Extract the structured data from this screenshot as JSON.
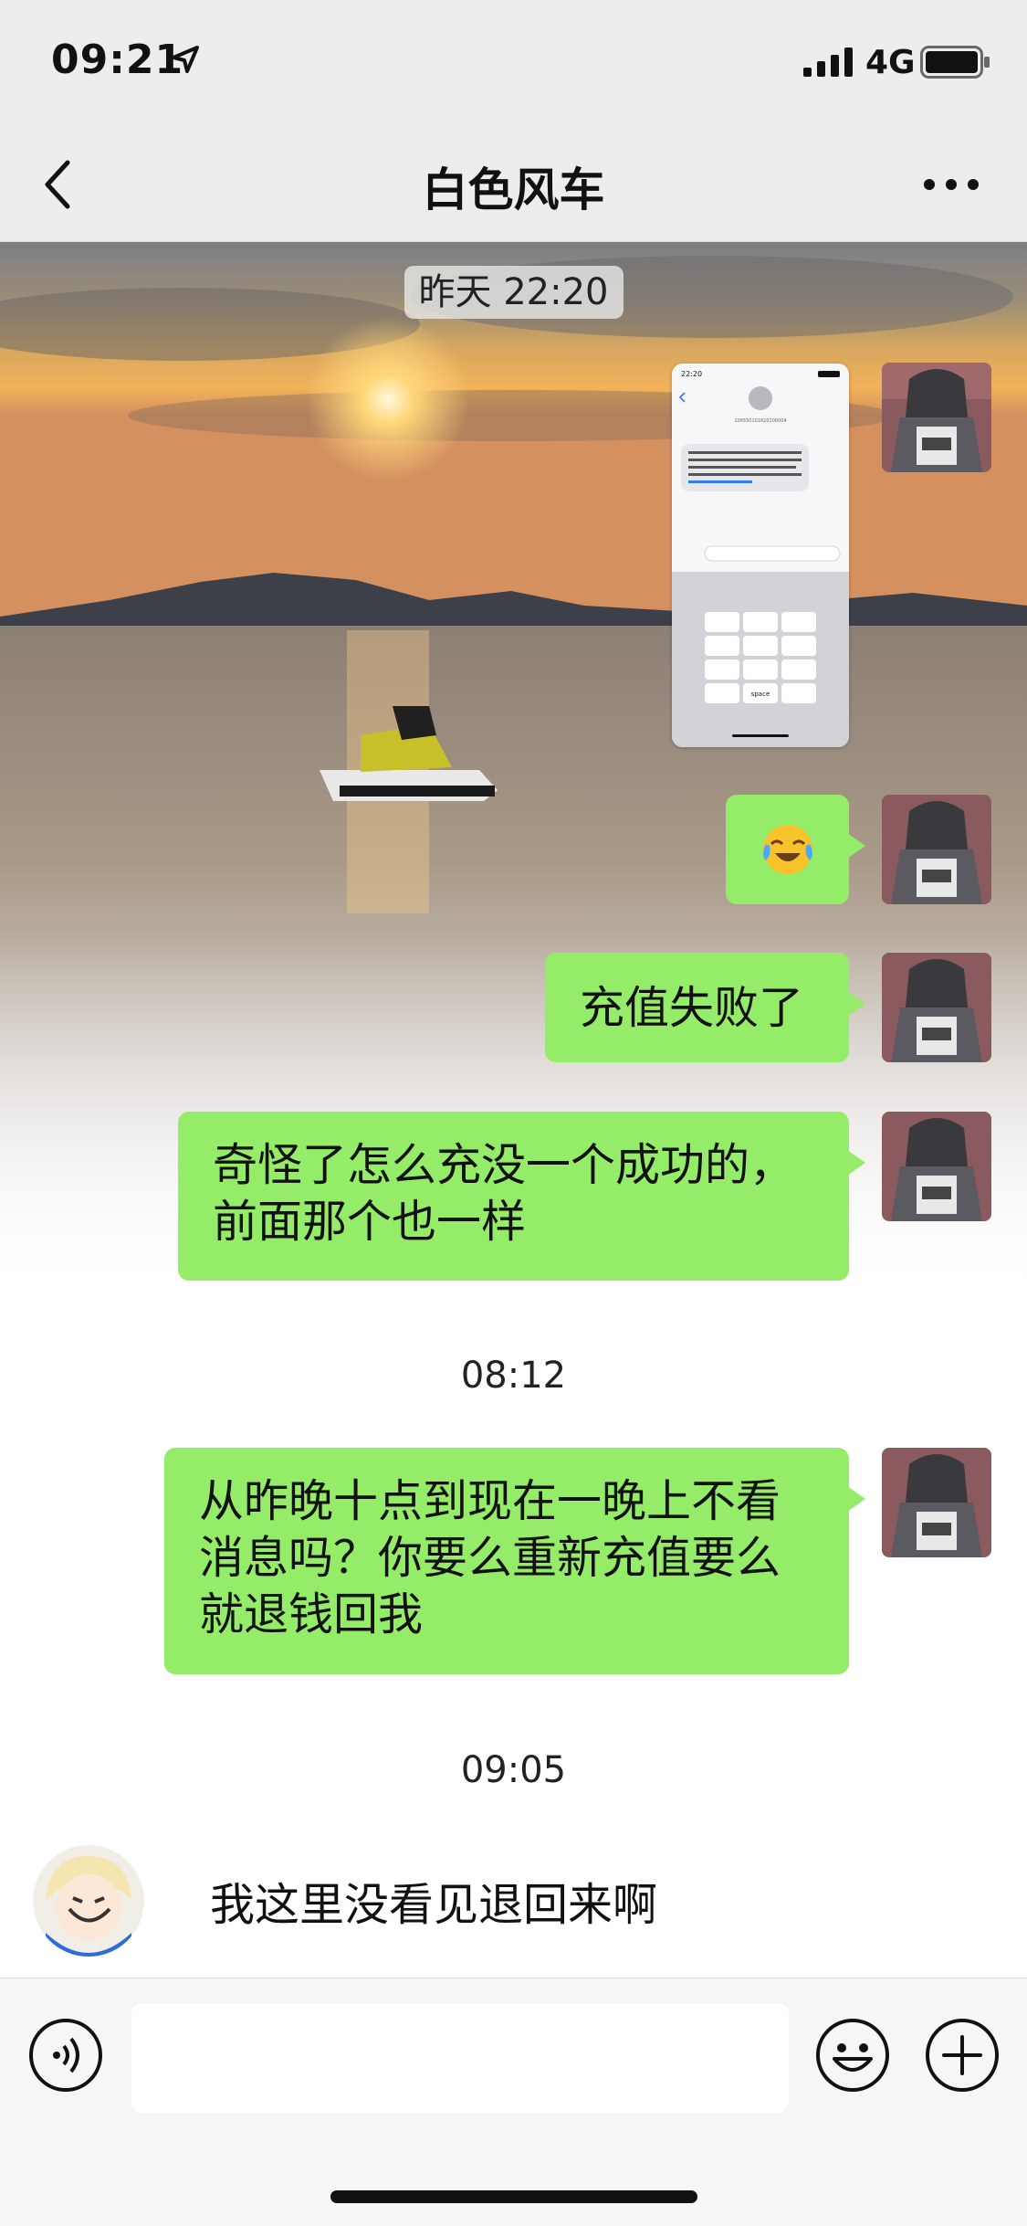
{
  "status_bar": {
    "time": "09:21",
    "network": "4G",
    "icons": [
      "location-arrow-icon",
      "cellular-signal-icon",
      "battery-icon"
    ]
  },
  "nav": {
    "title": "白色风车",
    "back_icon": "chevron-left-icon",
    "more_icon": "more-dots-icon"
  },
  "messages": {
    "ts_1": "昨天 22:20",
    "msg_2_emoji": "😭",
    "msg_3": "充值失败了",
    "msg_4_line1": "奇怪了怎么充没一个成功的，",
    "msg_4_line2": "前面那个也一样",
    "ts_2": "08:12",
    "msg_5_line1": "从昨晚十点到现在一晚上不看",
    "msg_5_line2": "消息吗？你要么重新充值要么",
    "msg_5_line3": "就退钱回我",
    "ts_3": "09:05",
    "incoming_1": "我这里没看见退回来啊"
  },
  "screenshot_message": {
    "time": "22:20",
    "sender_number": "106550101820100004",
    "text": "尊敬的用户，您好！因运营商系统维护，您充值的 30 元话费失败，金额已原路退回，请查收！如有疑问请拨电客服：4007988852【掌上银行】",
    "keyboard_keys": [
      "，",
      "ABC",
      "DEF",
      "⌫",
      "GHI",
      "JKL",
      "MNO",
      "清除",
      "PQRS",
      "TUV",
      "WXYZ",
      "符号",
      "123",
      "space",
      "中文",
      "换行"
    ]
  },
  "input_bar": {
    "icons": [
      "voice-icon",
      "emoji-icon",
      "plus-icon"
    ]
  },
  "colors": {
    "bubble_out": "#95ec69",
    "nav_bg": "#ededed",
    "input_bg": "#f6f6f6"
  }
}
